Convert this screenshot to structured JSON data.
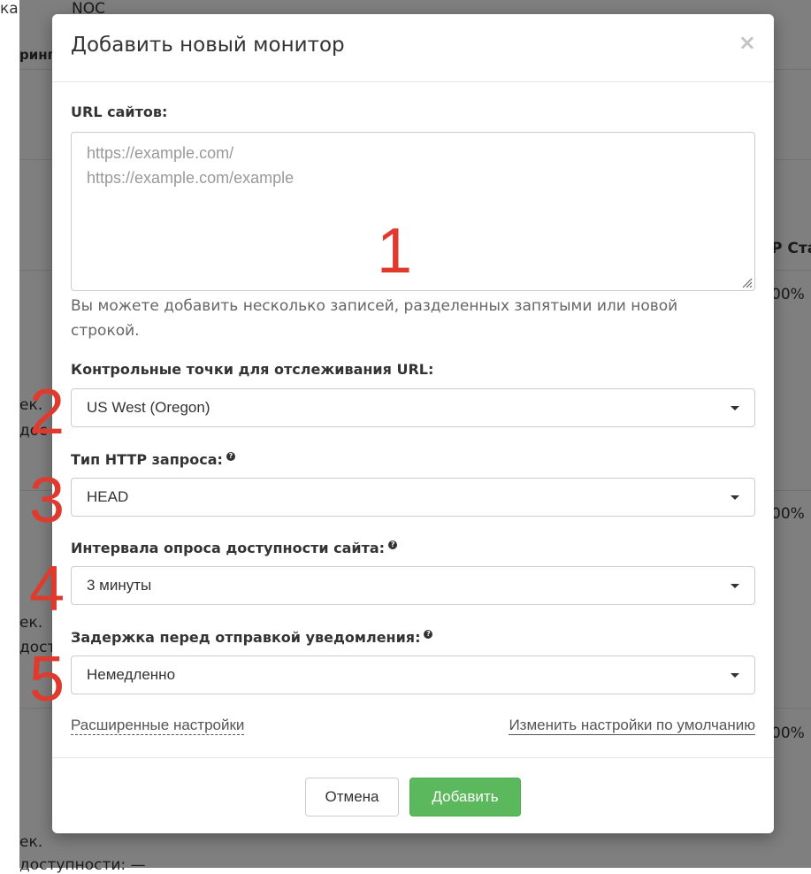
{
  "background": {
    "top_left_text": "ка",
    "top_text": "NOC",
    "header_left_text": "ринг",
    "column_header": "P Ста",
    "percent_1": "00%",
    "percent_2": "00%",
    "percent_3": "00%",
    "row1_a": "ек.",
    "row1_b": "дос",
    "row2_a": "ек.",
    "row2_b": "дост",
    "row3_a": "ек.",
    "row3_b": "доступности: —"
  },
  "modal": {
    "title": "Добавить новый монитор",
    "close_symbol": "×",
    "urls": {
      "label": "URL сайтов:",
      "placeholder_lines": [
        "https://example.com/",
        "https://example.com/example"
      ],
      "hint": "Вы можете добавить несколько записей, разделенных запятыми или новой строкой."
    },
    "checkpoints": {
      "label": "Контрольные точки для отслеживания URL:",
      "value": "US West (Oregon)"
    },
    "http_type": {
      "label": "Тип HTTP запроса:",
      "value": "HEAD"
    },
    "interval": {
      "label": "Интервала опроса доступности сайта:",
      "value": "3 минуты"
    },
    "delay": {
      "label": "Задержка перед отправкой уведомления:",
      "value": "Немедленно"
    },
    "advanced_link": "Расширенные настройки",
    "defaults_link": "Изменить настройки по умолчанию",
    "cancel_label": "Отмена",
    "add_label": "Добавить"
  },
  "annotations": [
    "1",
    "2",
    "3",
    "4",
    "5"
  ],
  "colors": {
    "annotation": "#e03a2f",
    "primary_button": "#5cb85c"
  }
}
